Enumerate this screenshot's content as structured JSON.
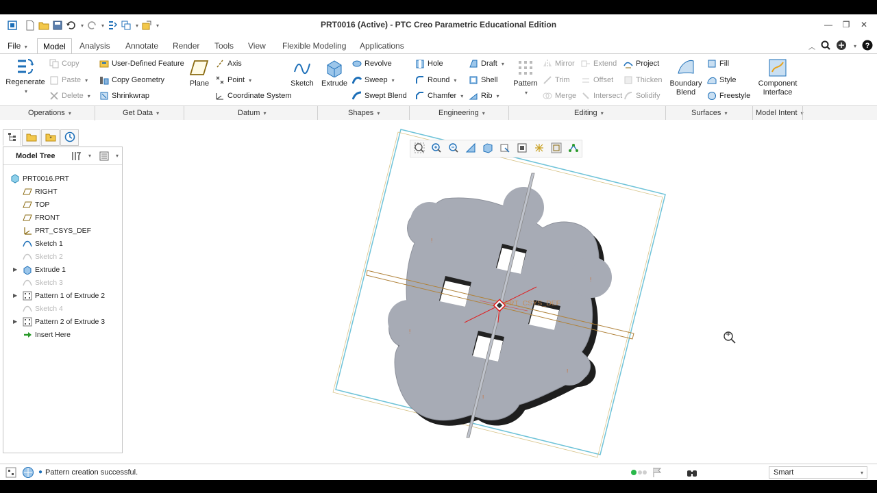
{
  "window": {
    "title": "PRT0016 (Active) - PTC Creo Parametric Educational Edition"
  },
  "tabs": [
    {
      "label": "File",
      "dropdown": "▾"
    },
    {
      "label": "Model"
    },
    {
      "label": "Analysis"
    },
    {
      "label": "Annotate"
    },
    {
      "label": "Render"
    },
    {
      "label": "Tools"
    },
    {
      "label": "View"
    },
    {
      "label": "Flexible Modeling"
    },
    {
      "label": "Applications"
    }
  ],
  "ribbon": {
    "operations": {
      "regenerate": "Regenerate",
      "copy": "Copy",
      "paste": "Paste",
      "delete": "Delete"
    },
    "get_data": {
      "udf": "User-Defined Feature",
      "copy_geometry": "Copy Geometry",
      "shrinkwrap": "Shrinkwrap"
    },
    "datum": {
      "plane": "Plane",
      "axis": "Axis",
      "point": "Point",
      "csys": "Coordinate System"
    },
    "shapes": {
      "sketch": "Sketch",
      "extrude": "Extrude",
      "revolve": "Revolve",
      "sweep": "Sweep",
      "swept_blend": "Swept Blend"
    },
    "engineering": {
      "hole": "Hole",
      "round": "Round",
      "chamfer": "Chamfer",
      "draft": "Draft",
      "shell": "Shell",
      "rib": "Rib"
    },
    "editing": {
      "pattern": "Pattern",
      "mirror": "Mirror",
      "trim": "Trim",
      "merge": "Merge",
      "extend": "Extend",
      "offset": "Offset",
      "intersect": "Intersect",
      "project": "Project",
      "thicken": "Thicken",
      "solidify": "Solidify"
    },
    "surfaces": {
      "boundary_blend_1": "Boundary",
      "boundary_blend_2": "Blend",
      "fill": "Fill",
      "style": "Style",
      "freestyle": "Freestyle"
    },
    "model_intent": {
      "component_interface_1": "Component",
      "component_interface_2": "Interface"
    },
    "groups": [
      "Operations",
      "Get Data",
      "Datum",
      "Shapes",
      "Engineering",
      "Editing",
      "Surfaces",
      "Model Intent"
    ]
  },
  "model_tree": {
    "title": "Model Tree",
    "items": [
      {
        "label": "PRT0016.PRT"
      },
      {
        "label": "RIGHT"
      },
      {
        "label": "TOP"
      },
      {
        "label": "FRONT"
      },
      {
        "label": "PRT_CSYS_DEF"
      },
      {
        "label": "Sketch 1"
      },
      {
        "label": "Sketch 2"
      },
      {
        "label": "Extrude 1"
      },
      {
        "label": "Sketch 3"
      },
      {
        "label": "Pattern 1 of Extrude 2"
      },
      {
        "label": "Sketch 4"
      },
      {
        "label": "Pattern 2 of Extrude 3"
      },
      {
        "label": "Insert Here"
      }
    ]
  },
  "graphics": {
    "csys_label": "PRT_CSYS_DEF"
  },
  "status": {
    "message": "Pattern creation successful.",
    "filter": "Smart"
  },
  "colors": {
    "accent_blue": "#1d6fb8",
    "part_gray": "#a7abb5",
    "datum_plane": "#6fc3d8",
    "csys_red": "#e02020"
  }
}
